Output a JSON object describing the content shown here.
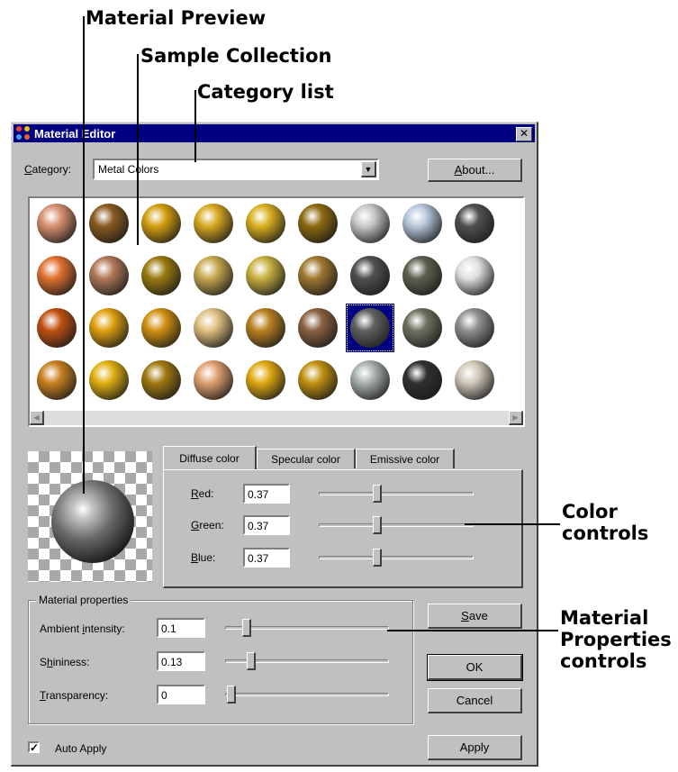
{
  "callouts": {
    "material_preview": "Material Preview",
    "sample_collection": "Sample Collection",
    "category_list": "Category list",
    "color_controls_1": "Color",
    "color_controls_2": "controls",
    "material_props_1": "Material",
    "material_props_2": "Properties",
    "material_props_3": "controls"
  },
  "dialog": {
    "title": "Material Editor",
    "close_glyph": "✕",
    "category_label_u": "C",
    "category_label_rest": "ategory:",
    "category_value": "Metal Colors",
    "about_u": "A",
    "about_rest": "bout..."
  },
  "samples": {
    "selected_row": 2,
    "selected_col": 6,
    "rows": [
      [
        "#d89070",
        "#8a5a20",
        "#d4a010",
        "#d8a820",
        "#d8b020",
        "#8c6a10",
        "#c8c8c8",
        "#b8c8dc",
        "#505050"
      ],
      [
        "#e07030",
        "#b07858",
        "#9a7a10",
        "#c8a850",
        "#c8b040",
        "#a07830",
        "#505050",
        "#606050",
        "#e0e0e0"
      ],
      [
        "#c05010",
        "#e0a010",
        "#d09010",
        "#e0c080",
        "#b88020",
        "#8a6040",
        "#606060",
        "#707060",
        "#909090"
      ],
      [
        "#c88020",
        "#e0b010",
        "#a07810",
        "#e0a070",
        "#e0a810",
        "#c09010",
        "#a8b0b0",
        "#303030",
        "#d0c8b8"
      ]
    ]
  },
  "tabs": [
    {
      "label": "Diffuse color",
      "active": true
    },
    {
      "label": "Specular color",
      "active": false
    },
    {
      "label": "Emissive color",
      "active": false
    }
  ],
  "color": {
    "red_u": "R",
    "red_rest": "ed:",
    "red_value": "0.37",
    "red_level": 0.37,
    "green_u": "G",
    "green_rest": "reen:",
    "green_value": "0.37",
    "green_level": 0.37,
    "blue_u": "B",
    "blue_rest": "lue:",
    "blue_value": "0.37",
    "blue_level": 0.37
  },
  "material": {
    "group_title": "Material properties",
    "ambient_a": "Ambient ",
    "ambient_u": "i",
    "ambient_b": "ntensity:",
    "ambient_value": "0.1",
    "ambient_level": 0.1,
    "shininess_a": "S",
    "shininess_u": "h",
    "shininess_b": "ininess:",
    "shininess_value": "0.13",
    "shininess_level": 0.13,
    "transparency_u": "T",
    "transparency_rest": "ransparency:",
    "transparency_value": "0",
    "transparency_level": 0
  },
  "buttons": {
    "save_u": "S",
    "save_rest": "ave",
    "ok": "OK",
    "cancel": "Cancel",
    "apply": "Apply"
  },
  "auto_apply": {
    "label": "Auto Apply",
    "checked": true,
    "check_glyph": "✓"
  },
  "colors": {
    "titlebar": "#000080",
    "dialog": "#c0c0c0",
    "selection": "#000080"
  }
}
